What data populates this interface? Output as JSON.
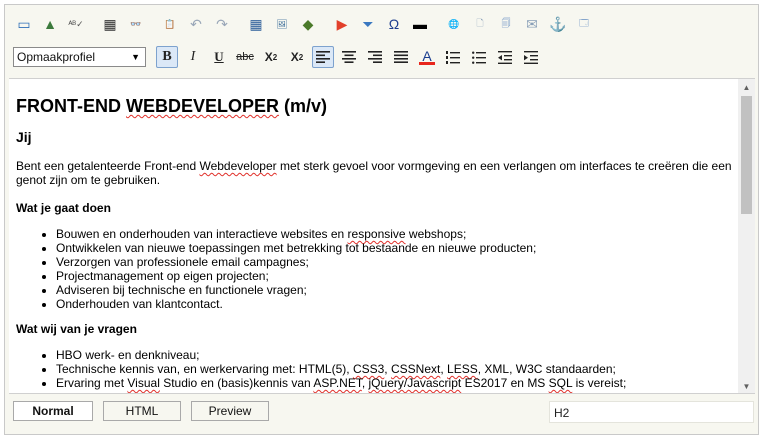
{
  "toolbar": {
    "row1": [
      {
        "name": "form-icon",
        "glyph": "▭",
        "color": "#2f6fb7"
      },
      {
        "name": "chart-icon",
        "glyph": "▲",
        "color": "#3c7a3c"
      },
      {
        "name": "spellcheck-icon",
        "glyph": "ᴬᴮ✓",
        "color": "#555"
      },
      {
        "name": "calculator-icon",
        "glyph": "▦",
        "color": "#333"
      },
      {
        "name": "binoculars-icon",
        "glyph": "👓",
        "color": "#333"
      },
      {
        "name": "paste-icon",
        "glyph": "📋",
        "color": "#b8860b"
      },
      {
        "name": "undo-icon",
        "glyph": "↶",
        "color": "#9aa7b8"
      },
      {
        "name": "redo-icon",
        "glyph": "↷",
        "color": "#9aa7b8"
      },
      {
        "name": "table-icon",
        "glyph": "▦",
        "color": "#2e5f9a"
      },
      {
        "name": "image-icon",
        "glyph": "🖼",
        "color": "#3c6e9a"
      },
      {
        "name": "flash-icon",
        "glyph": "◆",
        "color": "#4b7a2a"
      },
      {
        "name": "media-play-icon",
        "glyph": "▶",
        "color": "#e2402a"
      },
      {
        "name": "filter-icon",
        "glyph": "⏷",
        "color": "#3a78c0"
      },
      {
        "name": "special-char-icon",
        "glyph": "Ω",
        "color": "#1f3f8f"
      },
      {
        "name": "horizontal-rule-icon",
        "glyph": "▬",
        "color": "#000"
      },
      {
        "name": "link-icon",
        "glyph": "🌐",
        "color": "#888"
      },
      {
        "name": "document-icon",
        "glyph": "🗋",
        "color": "#8aa0b8"
      },
      {
        "name": "templates-icon",
        "glyph": "🗐",
        "color": "#4a7ab8"
      },
      {
        "name": "email-icon",
        "glyph": "✉",
        "color": "#8aa0b8"
      },
      {
        "name": "anchor-icon",
        "glyph": "⚓",
        "color": "#2e5f9a"
      },
      {
        "name": "window-icon",
        "glyph": "🗔",
        "color": "#4a7ab8"
      }
    ],
    "row2": {
      "style_select": "Opmaakprofiel",
      "style_arrow": "▼",
      "bold": "B",
      "italic": "I",
      "underline": "U",
      "strike": "abc",
      "subscript": "X",
      "subscript_mark": "2",
      "superscript": "X",
      "superscript_mark": "2",
      "align_left": "≡",
      "align_center": "≡",
      "align_right": "≡",
      "justify": "≡",
      "font_color": "A",
      "font_color_bar": "#e8261d",
      "ordered_list": "⒈",
      "unordered_list": "☰",
      "outdent": "⇤",
      "indent": "⇥"
    }
  },
  "document": {
    "title_part1": "FRONT-END ",
    "title_part2": "WEBDEVELOPER",
    "title_part3": " (m/v)",
    "intro_heading": "Jij",
    "intro_text_1": "Bent een getalenteerde Front-end ",
    "intro_text_spell": "Webdeveloper",
    "intro_text_2": " met sterk gevoel voor vormgeving en een verlangen om interfaces te creëren die een genot zijn om te gebruiken.",
    "section1_heading": "Wat je gaat doen",
    "section1_items": [
      {
        "a": "Bouwen en onderhouden van interactieve websites en ",
        "spell": "responsive",
        "b": " webshops;"
      },
      {
        "a": "Ontwikkelen van nieuwe toepassingen met betrekking tot bestaande en nieuwe producten;",
        "spell": "",
        "b": ""
      },
      {
        "a": "Verzorgen van professionele email campagnes;",
        "spell": "",
        "b": ""
      },
      {
        "a": "Projectmanagement op eigen projecten;",
        "spell": "",
        "b": ""
      },
      {
        "a": "Adviseren bij technische en functionele vragen;",
        "spell": "",
        "b": ""
      },
      {
        "a": "Onderhouden van klantcontact.",
        "spell": "",
        "b": ""
      }
    ],
    "section2_heading": "Wat wij van je vragen",
    "section2_items": [
      "HBO werk- en denkniveau;",
      "Technische kennis van, en werkervaring met: HTML(5), CSS3, CSSNext, LESS, XML, W3C standaarden;",
      "Ervaring met Visual Studio en (basis)kennis van ASP.NET, jQuery/Javascript ES2017 en MS SQL is vereist;"
    ]
  },
  "scrollbar": {
    "up": "▲",
    "down": "▼"
  },
  "modes": {
    "normal": "Normal",
    "html": "HTML",
    "preview": "Preview"
  },
  "element_path": "H2"
}
